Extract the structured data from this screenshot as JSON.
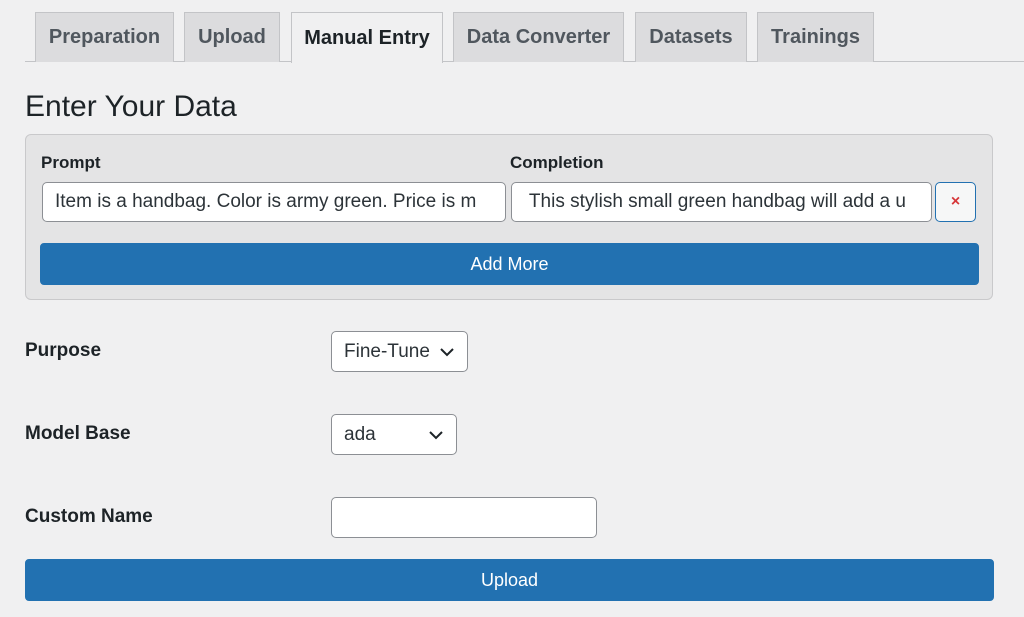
{
  "tabs": [
    {
      "label": "Preparation",
      "active": false
    },
    {
      "label": "Upload",
      "active": false
    },
    {
      "label": "Manual Entry",
      "active": true
    },
    {
      "label": "Data Converter",
      "active": false
    },
    {
      "label": "Datasets",
      "active": false
    },
    {
      "label": "Trainings",
      "active": false
    }
  ],
  "page_title": "Enter Your Data",
  "entry": {
    "prompt_label": "Prompt",
    "completion_label": "Completion",
    "rows": [
      {
        "prompt": "Item is a handbag. Color is army green. Price is m",
        "completion": " This stylish small green handbag will add a u"
      }
    ],
    "remove_icon": "×",
    "add_more_label": "Add More"
  },
  "purpose": {
    "label": "Purpose",
    "selected": "Fine-Tune"
  },
  "model_base": {
    "label": "Model Base",
    "selected": "ada"
  },
  "custom_name": {
    "label": "Custom Name",
    "value": "",
    "placeholder": ""
  },
  "upload_label": "Upload",
  "colors": {
    "primary": "#2271b1",
    "remove": "#d63638",
    "background": "#f0f0f1"
  }
}
